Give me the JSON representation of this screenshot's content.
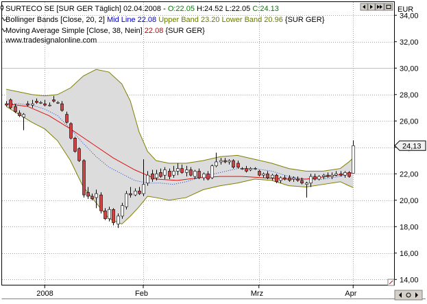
{
  "legend": {
    "line1": [
      {
        "text": "SURTECO SE [SUR GER  Täglich] 02.04.2008 - ",
        "color": "#000000"
      },
      {
        "text": "O:22.05",
        "color": "#008000"
      },
      {
        "text": " H:24.52 L:22.05 ",
        "color": "#000000"
      },
      {
        "text": "C:24.13",
        "color": "#008000"
      }
    ],
    "line2": [
      {
        "text": "Bollinger Bands [Close, 20, 2] ",
        "color": "#000000"
      },
      {
        "text": "Mid Line 22.08 ",
        "color": "#0000cc"
      },
      {
        "text": "Upper Band 23.20 Lower Band 20.96 ",
        "color": "#6b7a00"
      },
      {
        "text": "{SUR GER}",
        "color": "#000000"
      }
    ],
    "line3": [
      {
        "text": "Moving Average Simple [Close, 38, Nein] ",
        "color": "#000000"
      },
      {
        "text": "22.08 ",
        "color": "#cc0000"
      },
      {
        "text": "{SUR GER}",
        "color": "#000000"
      }
    ],
    "watermark": "www.tradesignalonline.com"
  },
  "axis": {
    "currency": "EUR",
    "price_tag": "24,13"
  },
  "colors": {
    "frame": "#000000",
    "band_fill": "#dcdcdc",
    "band_line": "#7f7f00",
    "mid_line": "#1f3fcf",
    "ma_line": "#dd1111",
    "up": "#ffffff",
    "down": "#cc4444",
    "grid": "#a0a0a0",
    "grid_30": "#a0d8a0"
  },
  "chart_data": {
    "type": "candlestick",
    "y_ticks": [
      "14,00",
      "16,00",
      "18,00",
      "20,00",
      "22,00",
      "24,00",
      "26,00",
      "28,00",
      "30,00",
      "32,00",
      "34,00"
    ],
    "ylim": [
      13.6,
      35.0
    ],
    "x_ticks": [
      {
        "label": "2008",
        "index": 9
      },
      {
        "label": "Feb",
        "index": 32
      },
      {
        "label": "Mrz",
        "index": 59
      },
      {
        "label": "Apr",
        "index": 81
      }
    ],
    "candles": [
      {
        "o": 27.3,
        "h": 27.5,
        "l": 27.1,
        "c": 27.2
      },
      {
        "o": 27.6,
        "h": 27.7,
        "l": 26.9,
        "c": 27.0
      },
      {
        "o": 27.1,
        "h": 27.3,
        "l": 26.6,
        "c": 26.7
      },
      {
        "o": 26.6,
        "h": 26.8,
        "l": 26.3,
        "c": 26.4
      },
      {
        "o": 26.3,
        "h": 26.6,
        "l": 25.3,
        "c": 26.5
      },
      {
        "o": 27.3,
        "h": 27.5,
        "l": 27.1,
        "c": 27.2
      },
      {
        "o": 27.2,
        "h": 27.6,
        "l": 27.0,
        "c": 27.3
      },
      {
        "o": 27.5,
        "h": 27.7,
        "l": 27.3,
        "c": 27.4
      },
      {
        "o": 27.4,
        "h": 27.5,
        "l": 27.3,
        "c": 27.4
      },
      {
        "o": 27.3,
        "h": 27.6,
        "l": 27.1,
        "c": 27.2
      },
      {
        "o": 27.2,
        "h": 27.4,
        "l": 27.1,
        "c": 27.2
      },
      {
        "o": 27.6,
        "h": 27.9,
        "l": 27.4,
        "c": 27.5
      },
      {
        "o": 27.4,
        "h": 27.5,
        "l": 27.3,
        "c": 27.4
      },
      {
        "o": 27.3,
        "h": 27.5,
        "l": 26.7,
        "c": 26.8
      },
      {
        "o": 26.5,
        "h": 26.7,
        "l": 25.8,
        "c": 25.9
      },
      {
        "o": 25.8,
        "h": 25.9,
        "l": 24.6,
        "c": 24.7
      },
      {
        "o": 24.7,
        "h": 24.8,
        "l": 23.6,
        "c": 23.7
      },
      {
        "o": 23.9,
        "h": 24.0,
        "l": 22.9,
        "c": 23.0
      },
      {
        "o": 23.0,
        "h": 23.1,
        "l": 20.2,
        "c": 20.4
      },
      {
        "o": 20.6,
        "h": 21.0,
        "l": 20.1,
        "c": 20.3
      },
      {
        "o": 20.3,
        "h": 20.5,
        "l": 20.0,
        "c": 20.1
      },
      {
        "o": 20.2,
        "h": 20.8,
        "l": 19.4,
        "c": 20.5
      },
      {
        "o": 20.4,
        "h": 20.6,
        "l": 19.0,
        "c": 19.2
      },
      {
        "o": 19.2,
        "h": 19.4,
        "l": 18.5,
        "c": 18.6
      },
      {
        "o": 18.6,
        "h": 19.5,
        "l": 18.4,
        "c": 19.3
      },
      {
        "o": 19.3,
        "h": 19.4,
        "l": 18.1,
        "c": 18.3
      },
      {
        "o": 18.2,
        "h": 19.0,
        "l": 17.9,
        "c": 18.8
      },
      {
        "o": 18.8,
        "h": 19.8,
        "l": 18.6,
        "c": 19.6
      },
      {
        "o": 19.5,
        "h": 20.7,
        "l": 19.3,
        "c": 20.5
      },
      {
        "o": 20.5,
        "h": 21.0,
        "l": 20.2,
        "c": 20.4
      },
      {
        "o": 20.4,
        "h": 20.9,
        "l": 20.3,
        "c": 20.7
      },
      {
        "o": 20.7,
        "h": 21.0,
        "l": 20.4,
        "c": 20.5
      },
      {
        "o": 20.5,
        "h": 23.1,
        "l": 20.3,
        "c": 21.2
      },
      {
        "o": 21.3,
        "h": 22.2,
        "l": 21.1,
        "c": 21.9
      },
      {
        "o": 22.0,
        "h": 22.3,
        "l": 21.4,
        "c": 21.6
      },
      {
        "o": 21.7,
        "h": 22.3,
        "l": 21.5,
        "c": 22.0
      },
      {
        "o": 22.1,
        "h": 22.4,
        "l": 21.7,
        "c": 21.8
      },
      {
        "o": 21.9,
        "h": 22.5,
        "l": 21.6,
        "c": 22.3
      },
      {
        "o": 22.2,
        "h": 22.4,
        "l": 21.6,
        "c": 21.8
      },
      {
        "o": 21.9,
        "h": 22.6,
        "l": 21.7,
        "c": 22.2
      },
      {
        "o": 22.2,
        "h": 22.8,
        "l": 21.9,
        "c": 22.4
      },
      {
        "o": 22.4,
        "h": 22.7,
        "l": 22.0,
        "c": 22.1
      },
      {
        "o": 22.1,
        "h": 22.6,
        "l": 21.8,
        "c": 22.3
      },
      {
        "o": 22.3,
        "h": 22.5,
        "l": 21.8,
        "c": 21.9
      },
      {
        "o": 21.8,
        "h": 22.3,
        "l": 21.6,
        "c": 22.2
      },
      {
        "o": 22.2,
        "h": 22.4,
        "l": 21.6,
        "c": 21.7
      },
      {
        "o": 21.7,
        "h": 22.1,
        "l": 21.5,
        "c": 22.0
      },
      {
        "o": 22.0,
        "h": 22.2,
        "l": 21.5,
        "c": 21.6
      },
      {
        "o": 21.7,
        "h": 22.7,
        "l": 21.6,
        "c": 22.6
      },
      {
        "o": 22.6,
        "h": 23.6,
        "l": 22.5,
        "c": 22.9
      },
      {
        "o": 22.9,
        "h": 23.2,
        "l": 22.7,
        "c": 23.0
      },
      {
        "o": 23.0,
        "h": 23.2,
        "l": 22.8,
        "c": 22.9
      },
      {
        "o": 22.9,
        "h": 23.1,
        "l": 22.7,
        "c": 23.0
      },
      {
        "o": 23.0,
        "h": 23.1,
        "l": 22.4,
        "c": 22.5
      },
      {
        "o": 22.8,
        "h": 23.0,
        "l": 22.4,
        "c": 22.5
      },
      {
        "o": 22.4,
        "h": 22.5,
        "l": 22.3,
        "c": 22.4
      },
      {
        "o": 22.4,
        "h": 22.6,
        "l": 22.1,
        "c": 22.2
      },
      {
        "o": 22.3,
        "h": 22.5,
        "l": 22.2,
        "c": 22.4
      },
      {
        "o": 22.4,
        "h": 22.5,
        "l": 22.3,
        "c": 22.4
      },
      {
        "o": 22.2,
        "h": 22.3,
        "l": 21.8,
        "c": 21.9
      },
      {
        "o": 21.9,
        "h": 22.1,
        "l": 21.7,
        "c": 22.0
      },
      {
        "o": 22.0,
        "h": 22.2,
        "l": 21.6,
        "c": 21.7
      },
      {
        "o": 21.7,
        "h": 22.0,
        "l": 21.5,
        "c": 21.9
      },
      {
        "o": 21.9,
        "h": 22.0,
        "l": 21.3,
        "c": 21.4
      },
      {
        "o": 21.5,
        "h": 21.8,
        "l": 21.3,
        "c": 21.7
      },
      {
        "o": 21.7,
        "h": 21.9,
        "l": 21.5,
        "c": 21.6
      },
      {
        "o": 21.7,
        "h": 21.9,
        "l": 21.4,
        "c": 21.5
      },
      {
        "o": 21.6,
        "h": 21.8,
        "l": 21.4,
        "c": 21.7
      },
      {
        "o": 21.6,
        "h": 21.8,
        "l": 21.4,
        "c": 21.5
      },
      {
        "o": 21.5,
        "h": 21.7,
        "l": 21.2,
        "c": 21.3
      },
      {
        "o": 21.2,
        "h": 21.4,
        "l": 20.2,
        "c": 21.3
      },
      {
        "o": 21.3,
        "h": 22.0,
        "l": 21.0,
        "c": 21.8
      },
      {
        "o": 21.8,
        "h": 22.0,
        "l": 21.5,
        "c": 21.6
      },
      {
        "o": 21.6,
        "h": 21.9,
        "l": 21.5,
        "c": 21.8
      },
      {
        "o": 21.8,
        "h": 22.0,
        "l": 21.6,
        "c": 21.9
      },
      {
        "o": 21.9,
        "h": 22.1,
        "l": 21.7,
        "c": 21.8
      },
      {
        "o": 21.8,
        "h": 22.1,
        "l": 21.6,
        "c": 21.9
      },
      {
        "o": 21.9,
        "h": 22.2,
        "l": 21.8,
        "c": 22.0
      },
      {
        "o": 22.0,
        "h": 22.2,
        "l": 21.8,
        "c": 21.9
      },
      {
        "o": 21.9,
        "h": 22.2,
        "l": 21.7,
        "c": 22.1
      },
      {
        "o": 22.1,
        "h": 22.2,
        "l": 21.7,
        "c": 21.8
      },
      {
        "o": 22.05,
        "h": 24.52,
        "l": 22.05,
        "c": 24.13
      }
    ],
    "bollinger": {
      "upper": [
        [
          0,
          28.4
        ],
        [
          3,
          28.2
        ],
        [
          6,
          28.0
        ],
        [
          9,
          27.9
        ],
        [
          12,
          28.0
        ],
        [
          15,
          28.5
        ],
        [
          18,
          29.4
        ],
        [
          21,
          29.9
        ],
        [
          24,
          29.7
        ],
        [
          27,
          28.8
        ],
        [
          29,
          27.5
        ],
        [
          31,
          25.2
        ],
        [
          33,
          23.7
        ],
        [
          35,
          23.0
        ],
        [
          38,
          22.8
        ],
        [
          42,
          22.8
        ],
        [
          46,
          23.0
        ],
        [
          50,
          23.3
        ],
        [
          54,
          23.4
        ],
        [
          58,
          23.1
        ],
        [
          62,
          22.8
        ],
        [
          66,
          22.4
        ],
        [
          70,
          22.2
        ],
        [
          74,
          22.2
        ],
        [
          78,
          22.4
        ],
        [
          80,
          22.9
        ],
        [
          81,
          23.2
        ]
      ],
      "lower": [
        [
          0,
          27.1
        ],
        [
          3,
          26.5
        ],
        [
          6,
          25.9
        ],
        [
          9,
          25.4
        ],
        [
          12,
          24.5
        ],
        [
          15,
          23.0
        ],
        [
          18,
          21.0
        ],
        [
          21,
          19.8
        ],
        [
          24,
          18.6
        ],
        [
          27,
          18.2
        ],
        [
          29,
          18.8
        ],
        [
          31,
          19.5
        ],
        [
          33,
          20.3
        ],
        [
          35,
          20.2
        ],
        [
          38,
          20.0
        ],
        [
          42,
          20.2
        ],
        [
          46,
          20.8
        ],
        [
          50,
          21.1
        ],
        [
          54,
          21.3
        ],
        [
          58,
          21.6
        ],
        [
          62,
          21.5
        ],
        [
          66,
          21.1
        ],
        [
          70,
          21.0
        ],
        [
          74,
          21.2
        ],
        [
          78,
          21.4
        ],
        [
          80,
          21.1
        ],
        [
          81,
          20.96
        ]
      ],
      "mid": [
        [
          0,
          27.3
        ],
        [
          3,
          27.3
        ],
        [
          6,
          27.2
        ],
        [
          9,
          26.9
        ],
        [
          12,
          26.4
        ],
        [
          15,
          25.4
        ],
        [
          18,
          24.3
        ],
        [
          21,
          23.3
        ],
        [
          24,
          22.5
        ],
        [
          27,
          22.0
        ],
        [
          30,
          21.5
        ],
        [
          33,
          21.3
        ],
        [
          36,
          21.3
        ],
        [
          39,
          21.2
        ],
        [
          42,
          21.4
        ],
        [
          46,
          21.8
        ],
        [
          50,
          22.1
        ],
        [
          54,
          22.4
        ],
        [
          58,
          22.4
        ],
        [
          62,
          22.2
        ],
        [
          66,
          21.8
        ],
        [
          70,
          21.6
        ],
        [
          74,
          21.6
        ],
        [
          78,
          21.8
        ],
        [
          81,
          22.08
        ]
      ]
    },
    "moving_average": [
      [
        0,
        27.3
      ],
      [
        5,
        27.1
      ],
      [
        10,
        26.4
      ],
      [
        15,
        25.4
      ],
      [
        20,
        24.3
      ],
      [
        25,
        23.2
      ],
      [
        30,
        22.3
      ],
      [
        35,
        21.6
      ],
      [
        40,
        21.5
      ],
      [
        45,
        21.7
      ],
      [
        50,
        21.8
      ],
      [
        55,
        21.8
      ],
      [
        60,
        21.7
      ],
      [
        65,
        21.6
      ],
      [
        70,
        21.6
      ],
      [
        75,
        21.8
      ],
      [
        81,
        22.08
      ]
    ],
    "reference_line": 30.0
  }
}
